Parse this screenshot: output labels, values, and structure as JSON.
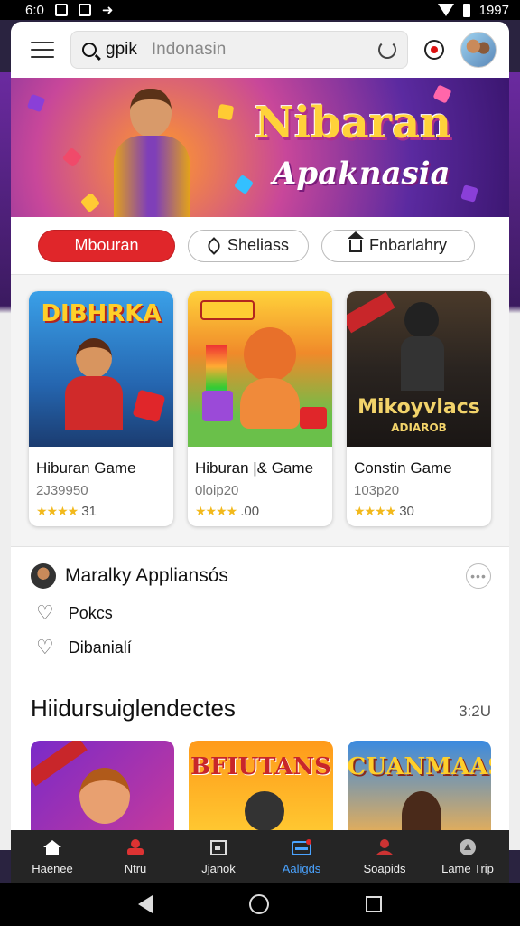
{
  "status": {
    "time_left": "6:0",
    "time_right": "1997"
  },
  "search": {
    "query": "gpik",
    "placeholder": "Indonasin"
  },
  "banner": {
    "title": "Nibaran",
    "subtitle": "Apaknasia"
  },
  "chips": [
    {
      "label": "Mbouran",
      "active": true
    },
    {
      "label": "Sheliass",
      "icon": "feather-icon",
      "active": false
    },
    {
      "label": "Fnbarlahry",
      "icon": "home-icon",
      "active": false
    }
  ],
  "cards": [
    {
      "art_title": "DIBHRKA",
      "name": "Hiburan Game",
      "meta": "2J39950",
      "stars": "★★★★",
      "rating": "31"
    },
    {
      "art_title": "",
      "name": "Hiburan |& Game",
      "meta": "0loip20",
      "stars": "★★★★",
      "rating": ".00"
    },
    {
      "art_title": "Mikoyvlacs",
      "art_sub": "ADIAROB",
      "name": "Constin Game",
      "meta": "103p20",
      "stars": "★★★★",
      "rating": "30"
    }
  ],
  "section": {
    "title": "Maralky Appliansós",
    "items": [
      {
        "label": "Pokcs"
      },
      {
        "label": "Dibanialí"
      }
    ]
  },
  "section2": {
    "title": "Hiidursuiglendectes",
    "count": "3:2U",
    "thumbs": [
      {
        "title": ""
      },
      {
        "title": "BFIUTANS"
      },
      {
        "title": "CUANMAAS"
      }
    ]
  },
  "bottom_nav": [
    {
      "label": "Haenee",
      "icon": "home-icon",
      "active": false
    },
    {
      "label": "Ntru",
      "icon": "person-icon",
      "active": false
    },
    {
      "label": "Jjanok",
      "icon": "box-icon",
      "active": false
    },
    {
      "label": "Aaligds",
      "icon": "card-icon",
      "active": true
    },
    {
      "label": "Soapids",
      "icon": "profile-icon",
      "active": false
    },
    {
      "label": "Lame Trip",
      "icon": "compass-icon",
      "active": false
    }
  ],
  "colors": {
    "accent": "#e0262a",
    "active_nav": "#4aa3ff",
    "star": "#f2b91c"
  }
}
